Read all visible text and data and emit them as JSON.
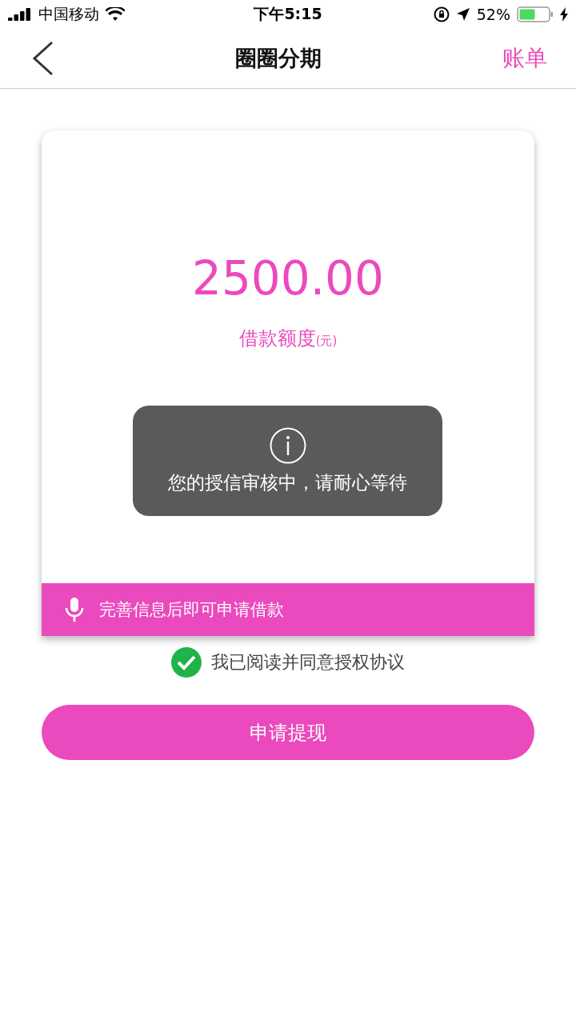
{
  "status_bar": {
    "carrier": "中国移动",
    "time": "下午5:15",
    "battery": "52%"
  },
  "nav": {
    "title": "圈圈分期",
    "action": "账单"
  },
  "card": {
    "amount": "2500.00",
    "amount_label": "借款额度",
    "amount_unit": "(元)",
    "notice": "完善信息后即可申请借款"
  },
  "toast": {
    "message": "您的授信审核中，请耐心等待"
  },
  "agreement": {
    "text": "我已阅读并同意授权协议",
    "checked": true
  },
  "submit": "申请提现"
}
